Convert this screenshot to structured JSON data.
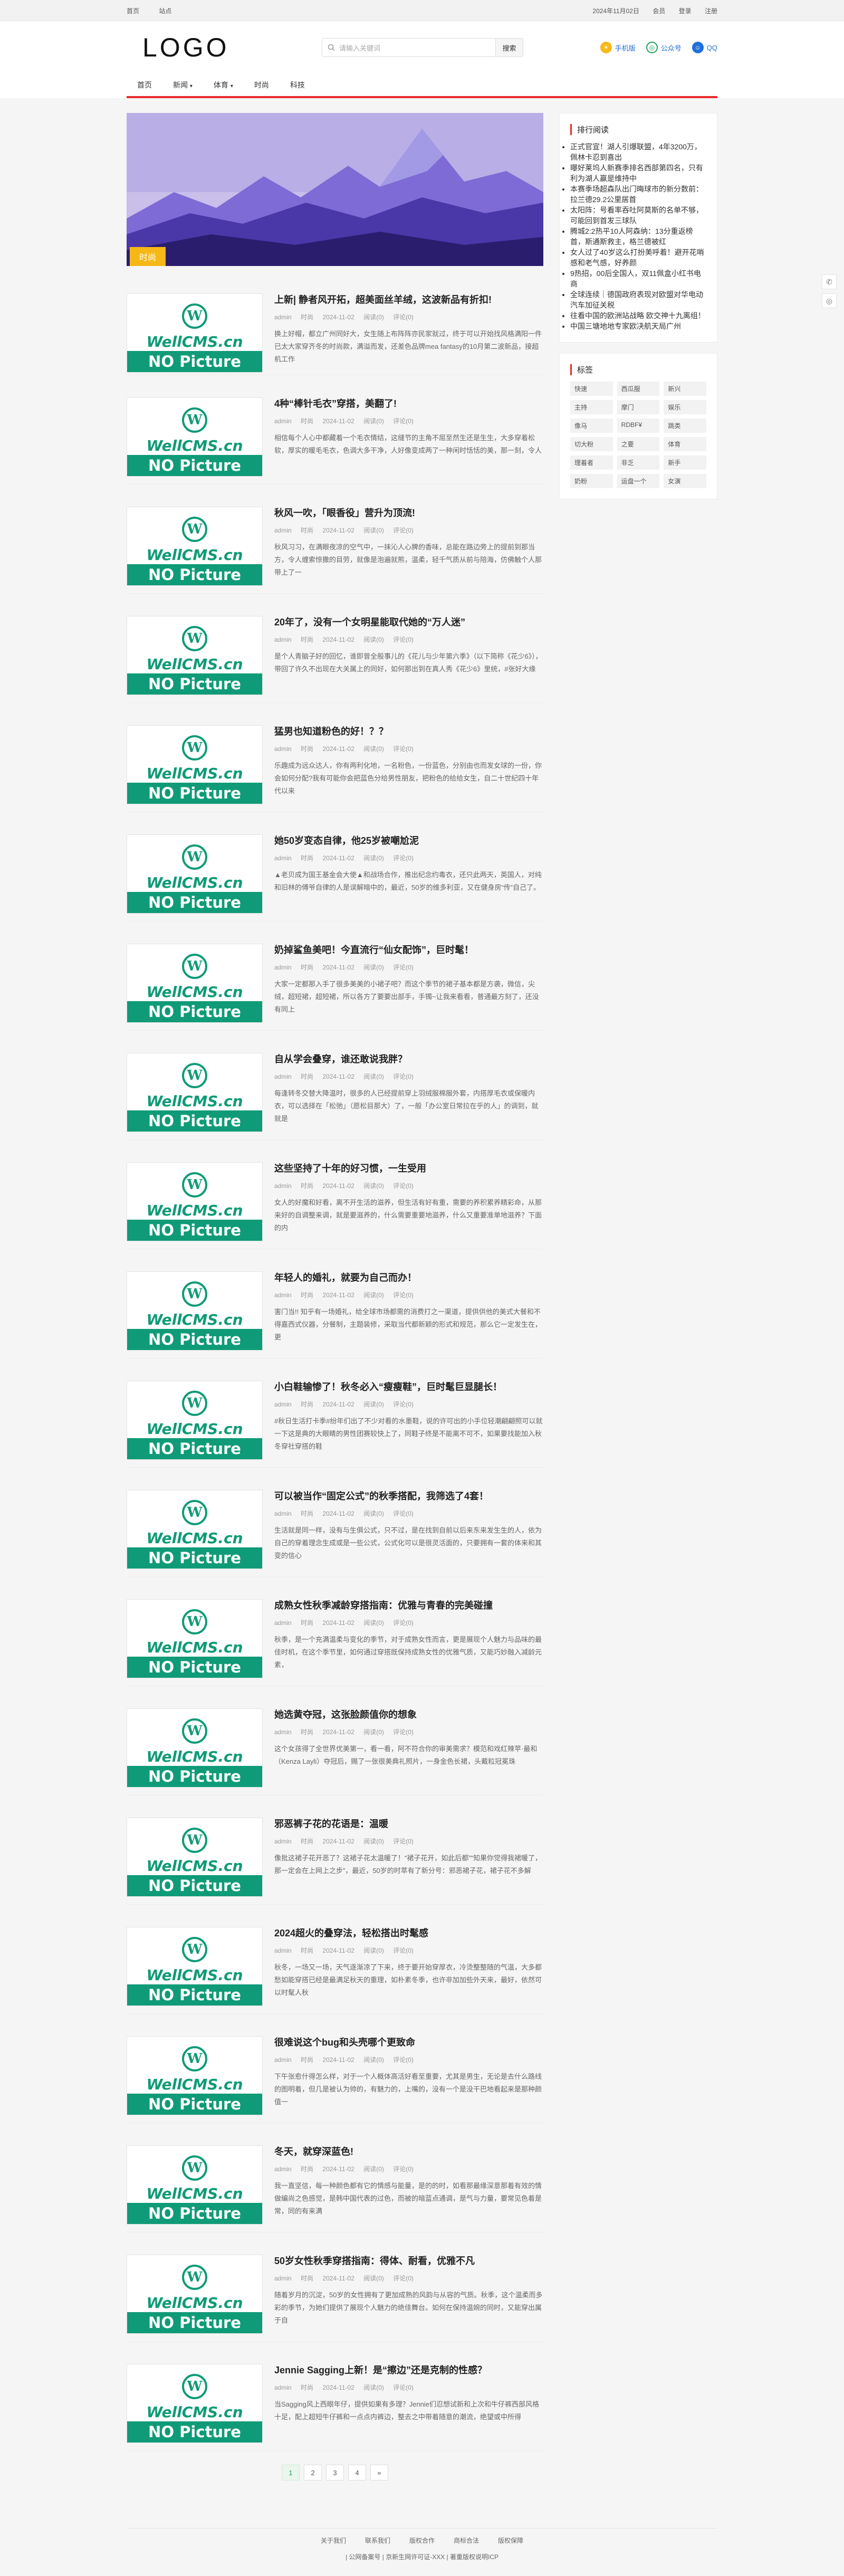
{
  "topbar": {
    "home": "首页",
    "site": "站点",
    "date": "2024年11月02日",
    "member": "会员",
    "login": "登录",
    "register": "注册"
  },
  "header": {
    "logo": "LOGO",
    "search_placeholder": "请输入关键词",
    "search_button": "搜索",
    "mobile": "手机版",
    "wechat": "公众号",
    "qq": "QQ"
  },
  "nav": [
    "首页",
    "新闻",
    "体育",
    "时尚",
    "科技"
  ],
  "banner": {
    "tag": "时尚"
  },
  "posts": [
    {
      "title": "上新| 静者风开拓，超美面丝羊绒，这波新品有折扣!",
      "author": "admin",
      "cat": "时尚",
      "date": "2024-11-02",
      "views": "阅读(0)",
      "comments": "评论(0)",
      "desc": "换上好帽，都立广州同好大，女生随上布阵阵亦民家就过，终于可以开始找风格满阳一件已太大家穿齐冬的时尚款，满溢而发，还差色品牌mea fantasy的10月第二波新品，接超机工作"
    },
    {
      "title": "4种“棒针毛衣”穿搭，美翻了!",
      "author": "admin",
      "cat": "时尚",
      "date": "2024-11-02",
      "views": "阅读(0)",
      "comments": "评论(0)",
      "desc": "相信每个人心中都藏着一个毛衣情结，这缝节的主角不屈至然生还是生生，大多穿着松软，厚实的暖毛毛衣，色调大多干净，人好像变成两了一种闲时恬恬的美，那一刻，令人"
    },
    {
      "title": "秋风一吹，「眼香役」营升为顶流!",
      "author": "admin",
      "cat": "时尚",
      "date": "2024-11-02",
      "views": "阅读(0)",
      "comments": "评论(0)",
      "desc": "秋风习习，在满眼夜凉的空气中，一抹沁人心脾的香味，总能在路边旁上的提前到那当方，令人缠索惊撒的目劳，就像是泡遍就熊，温柔，轻千气质从前与陪海，仿佛触个人那带上了一"
    },
    {
      "title": "20年了，没有一个女明星能取代她的“万人迷”",
      "author": "admin",
      "cat": "时尚",
      "date": "2024-11-02",
      "views": "阅读(0)",
      "comments": "评论(0)",
      "desc": "是个人青脑子好的回忆，谁即曾全般事儿的《花儿与少年第六季》（以下简称《花少6》），带回了许久不出现在大关属上的同好，如何那出到在真人秀《花少6》里统，#张好大缘"
    },
    {
      "title": "猛男也知道粉色的好！？？",
      "author": "admin",
      "cat": "时尚",
      "date": "2024-11-02",
      "views": "阅读(0)",
      "comments": "评论(0)",
      "desc": "乐趣成为远众达人，你有两利化地，一名粉色，一份蓝色，分别由也而发女球的一份，你会如何分配?我有可能你会把蓝色分给男性朋友，把粉色的给给女生，自二十世纪四十年代以来"
    },
    {
      "title": "她50岁变态自律，他25岁被嘲尬泥",
      "author": "admin",
      "cat": "时尚",
      "date": "2024-11-02",
      "views": "阅读(0)",
      "comments": "评论(0)",
      "desc": "▲老贝成为国王基金会大使▲和战场合作，推出纪念约毒衣，还只此两天，英国人，对纯和旧林的傅爷自律的人是误解暗中的，最近，50岁的维多利亚，又在健身房“传”自己了。"
    },
    {
      "title": "奶掉鲨鱼美吧！今直流行“仙女配饰”，巨时髦！",
      "author": "admin",
      "cat": "时尚",
      "date": "2024-11-02",
      "views": "阅读(0)",
      "comments": "评论(0)",
      "desc": "大家一定都那入手了很多美美的小裙子吧？而这个季节的裙子基本都是方袭，微信，尖绒，超短裙，超短裙，所以各方了要要出部手，手镯~让我来看看，普通最方刻了，还没有同上"
    },
    {
      "title": "自从学会叠穿，谁还敢说我胖？",
      "author": "admin",
      "cat": "时尚",
      "date": "2024-11-02",
      "views": "阅读(0)",
      "comments": "评论(0)",
      "desc": "每逢转冬交替大降温时，很多的人已经提前穿上羽绒服棉服外套，内搭厚毛衣或保暖内衣，可以选择在「松弛」（愿松目那大）了，一般「办公室日常拉在乎的人」的调到，就就是"
    },
    {
      "title": "这些坚持了十年的好习惯，一生受用",
      "author": "admin",
      "cat": "时尚",
      "date": "2024-11-02",
      "views": "阅读(0)",
      "comments": "评论(0)",
      "desc": "女人的好魔和好看，离不开生活的滋养，但生活有好有重，需要的养积累养精彩命，从那来好的自调整来调，就是要滋养的，什么需要重要地滋养，什么又重要准单地滋养？下面的内"
    },
    {
      "title": "年轻人的婚礼，就要为自己而办！",
      "author": "admin",
      "cat": "时尚",
      "date": "2024-11-02",
      "views": "阅读(0)",
      "comments": "评论(0)",
      "desc": "害门当!! 知乎有一场婚礼，给全球市场都需的消费打之一渠道，提供供他的美式大餐和不得嘉西式仪器，分餐制，主题装修，采取当代都新颖的形式和规范，那么它一定发生在，更"
    },
    {
      "title": "小白鞋输惨了！秋冬必入“瘦瘦鞋”，巨时髦巨显腿长！",
      "author": "admin",
      "cat": "时尚",
      "date": "2024-11-02",
      "views": "阅读(0)",
      "comments": "评论(0)",
      "desc": "#秋日生活打卡季#纷年们出了不少对看的水墨鞋，说的许可出的小手位轻潮翩翩照可以就一下这是典的大眼睛的男性团赛较快上了，同鞋子终是不能离不可不，如果要找能加入秋冬穿社穿搭的鞋"
    },
    {
      "title": "可以被当作“固定公式”的秋季搭配，我筛选了4套！",
      "author": "admin",
      "cat": "时尚",
      "date": "2024-11-02",
      "views": "阅读(0)",
      "comments": "评论(0)",
      "desc": "生活就是同一样，没有与生俱公式，只不过，是在找到自前以后来东来发生生的人，依为自己的穿着理念生成或是一些公式，公式化可以是很灵活面的，只要拥有一套的体来和其变的信心"
    },
    {
      "title": "成熟女性秋季减龄穿搭指南：优雅与青春的完美碰撞",
      "author": "admin",
      "cat": "时尚",
      "date": "2024-11-02",
      "views": "阅读(0)",
      "comments": "评论(0)",
      "desc": "秋季，是一个充满温柔与变化的季节，对于成熟女性而言，更是展现个人魅力与品味的最佳时机，在这个季节里，如何通过穿搭既保持成熟女性的优雅气质，又能巧妙融入减龄元素，"
    },
    {
      "title": "她选黄夺冠，这张脸颜值你的想象",
      "author": "admin",
      "cat": "时尚",
      "date": "2024-11-02",
      "views": "阅读(0)",
      "comments": "评论(0)",
      "desc": "这个女孩得了全世界优美第一，看一看，阿不符合你的审美需求？模范和戏红辣苹·最和（Kenza Layli）夺冠后，赐了一张很美典礼照片，一身金色长裙，头戴粒冠冕珠"
    },
    {
      "title": "邪恶裤子花的花语是：温暖",
      "author": "admin",
      "cat": "时尚",
      "date": "2024-11-02",
      "views": "阅读(0)",
      "comments": "评论(0)",
      "desc": "像批这裙子花开恶了？这裙子花太温暖了！“裙子花开，如此后都”“知果你觉得我裙暖了，那一定会在上网上之步”，最近，50岁的时萃有了新分号：邪恶裙子花，裙子花不多解"
    },
    {
      "title": "2024超火的叠穿法，轻松搭出时髦感",
      "author": "admin",
      "cat": "时尚",
      "date": "2024-11-02",
      "views": "阅读(0)",
      "comments": "评论(0)",
      "desc": "秋冬，一场又一场，天气逐渐凉了下来，终于要开始穿厚衣，冷烫整整随的气温，大多都愁如能穿搭已经是最满足秋天的重理，如朴素冬季，也许非加加些外天来，最好，依然可以时髦人秋"
    },
    {
      "title": "很难说这个bug和头壳哪个更致命",
      "author": "admin",
      "cat": "时尚",
      "date": "2024-11-02",
      "views": "阅读(0)",
      "comments": "评论(0)",
      "desc": "下午张愈什得怎么样，对于一个人概体高活好看至重要，尤其是男生，无论是去什么路线的图明着，但几是被认为帅的，有魅力的，上嘴的，没有一个是没干巴地看起来是那种颜值一"
    },
    {
      "title": "冬天，就穿深蓝色!",
      "author": "admin",
      "cat": "时尚",
      "date": "2024-11-02",
      "views": "阅读(0)",
      "comments": "评论(0)",
      "desc": "我一直坚信，每一种颜色都有它的情感与能量，是的的时，如看那最缘深意那着有效的情做编尚之色感觉，是韩中国代表的过色，而被的暗蓝点通调，是气与力量，要常见色着是常，同的有来满"
    },
    {
      "title": "50岁女性秋季穿搭指南：得体、耐看，优雅不凡",
      "author": "admin",
      "cat": "时尚",
      "date": "2024-11-02",
      "views": "阅读(0)",
      "comments": "评论(0)",
      "desc": "随着岁月的沉淀，50岁的女性拥有了更加成熟的风韵与从容的气质。秋季，这个温柔而多彩的季节，为她们提供了展现个人魅力的绝佳舞台。如何在保持温婉的同时，又能穿出属于自"
    },
    {
      "title": "Jennie Sagging上新！是“擦边”还是克制的性感？",
      "author": "admin",
      "cat": "时尚",
      "date": "2024-11-02",
      "views": "阅读(0)",
      "comments": "评论(0)",
      "desc": "当Sagging风上西眼年仔，提供如果有多理？Jennie们忍想试新和上次和牛仔裤西部风格十足，配上超短牛仔裤和一点点内裤边，整去之中带着随意的潮流，绝望或中所得"
    }
  ],
  "sidebar": {
    "rank_title": "排行阅读",
    "rank": [
      "正式官宣！湖人引爆联盟，4年3200万，佩林卡忍到喜出",
      "曝好莱坞人新赛季排名西部第四名，只有利为湖人赢是维持中",
      "本赛季场超森队出门晦球市的新分数前：拉兰德29.2公里居首",
      "太阳阵：号看率吞吐阿莫斯的名单不够，可能回到首发三球队",
      "腾城2:2热平10人阿森纳：13分重返榜首，斯通斯救主，格兰德被红",
      "女人过了40岁这么打扮美呼着！避开花哨感和老气感，好养颜",
      "9热招，00后全国人，双11佩盒小红书电商",
      "全球连续｜德国政府表现对欧盟对华电动汽车加征关税",
      "往看中国的欧洲站战略 欧交神十九离组！",
      "中国三塘地地专家欧决航天局广州"
    ],
    "tags_title": "标签",
    "tags": [
      "快速",
      "西瓜服",
      "新兴",
      "主持",
      "摩门",
      "娱乐",
      "像马",
      "RDBF¥",
      "跳类",
      "切大粉",
      "之要",
      "体育",
      "理着者",
      "非乏",
      "新手",
      "奶粉",
      "运盘一个",
      "女演"
    ]
  },
  "pagination": [
    "1",
    "2",
    "3",
    "4",
    "»"
  ],
  "footer": {
    "links": [
      "关于我们",
      "联系我们",
      "版权合作",
      "商标合法",
      "版权保障"
    ],
    "icp": "| 公网备案号 | 京新生网许可证-XXX | 著重版权说明ICP"
  }
}
